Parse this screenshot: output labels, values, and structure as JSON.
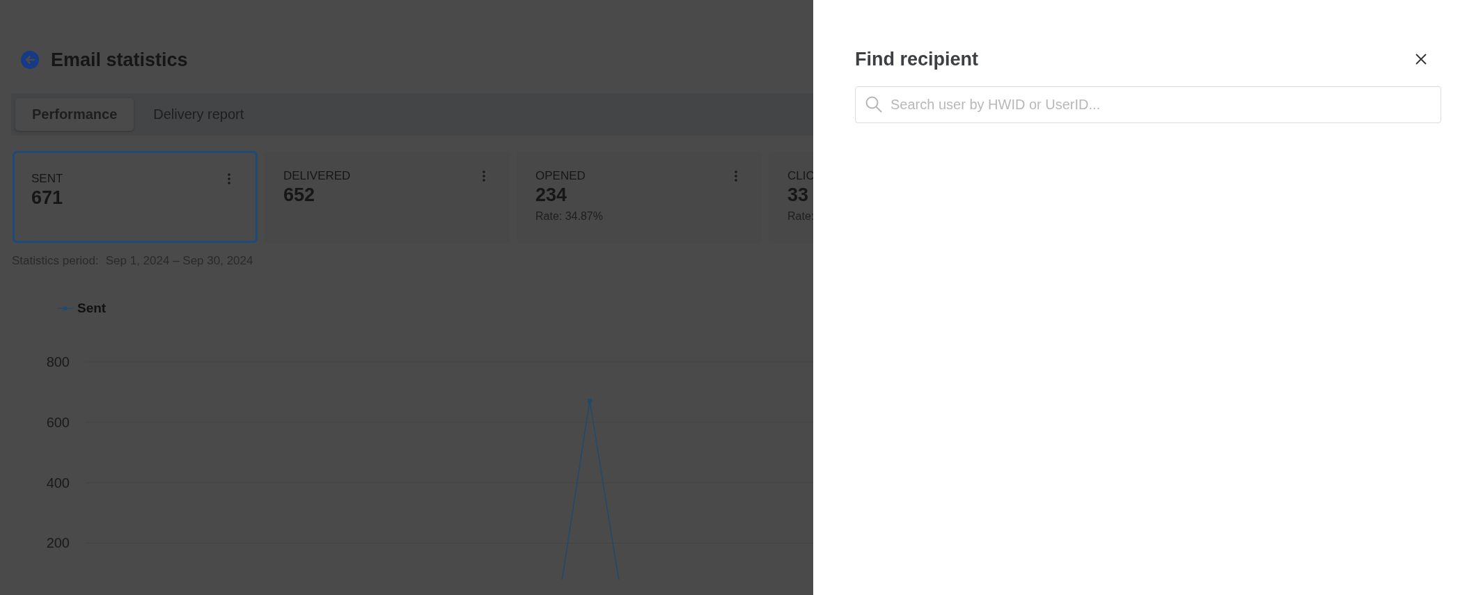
{
  "page": {
    "title": "Email statistics",
    "tabs": [
      {
        "label": "Performance",
        "selected": true
      },
      {
        "label": "Delivery report",
        "selected": false
      }
    ],
    "metrics": [
      {
        "label": "SENT",
        "value": "671",
        "selected": true
      },
      {
        "label": "DELIVERED",
        "value": "652",
        "selected": false
      },
      {
        "label": "OPENED",
        "value": "234",
        "rate": "Rate: 34.87%",
        "selected": false
      },
      {
        "label": "CLIC",
        "value": "33",
        "rate": "Rate:",
        "selected": false
      }
    ],
    "period_label": "Statistics period:",
    "period": "Sep 1, 2024 – Sep 30, 2024",
    "chart": {
      "legend": [
        "Sent"
      ],
      "y_labels": [
        "800",
        "600",
        "400",
        "200"
      ]
    }
  },
  "drawer": {
    "title": "Find recipient",
    "search": {
      "placeholder": "Search user by HWID or UserID..."
    }
  }
}
